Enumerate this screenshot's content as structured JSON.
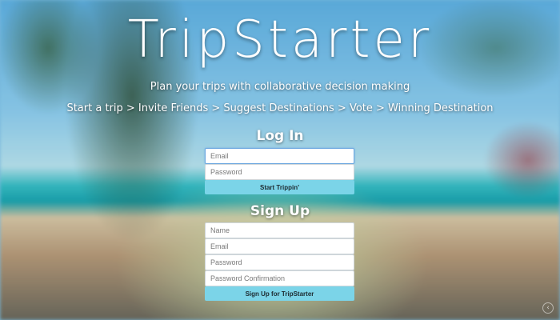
{
  "app": {
    "title": "TripStarter",
    "tagline": "Plan your trips with collaborative decision making",
    "steps": "Start a trip > Invite Friends > Suggest Destinations > Vote > Winning Destination"
  },
  "login": {
    "title": "Log In",
    "email_placeholder": "Email",
    "password_placeholder": "Password",
    "submit_label": "Start Trippin'"
  },
  "signup": {
    "title": "Sign Up",
    "name_placeholder": "Name",
    "email_placeholder": "Email",
    "password_placeholder": "Password",
    "password_confirm_placeholder": "Password Confirmation",
    "submit_label": "Sign Up for TripStarter"
  },
  "icons": {
    "corner": "chevron-left-icon"
  },
  "colors": {
    "button": "#7bd4e8",
    "text": "#ffffff"
  }
}
